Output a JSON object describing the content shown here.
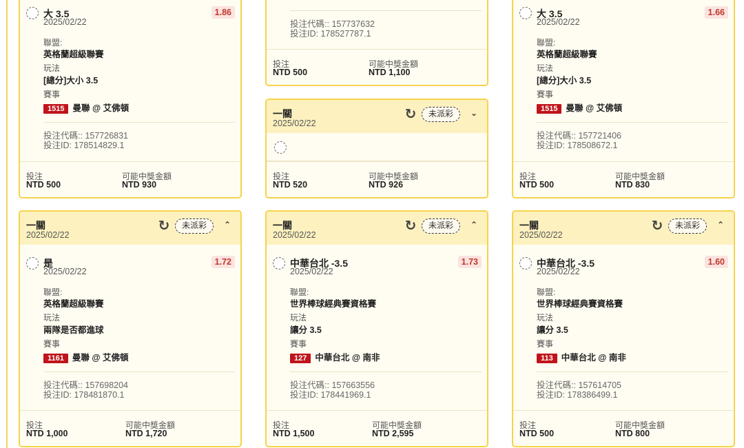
{
  "labels": {
    "league": "聯盟:",
    "market": "玩法",
    "match": "賽事",
    "bet_code": "投注代碼::",
    "bet_id": "投注ID:",
    "stake": "投注",
    "potential_win": "可能中獎金額"
  },
  "cards": [
    {
      "selection": "大 3.5",
      "date": "2025/02/22",
      "odds": "1.86",
      "league": "英格蘭超級聯賽",
      "market": "[總分]大小 3.5",
      "match_no": "1515",
      "match": "曼聯 @ 艾佛頓",
      "bet_code": "157726831",
      "bet_id": "178514829.1",
      "stake": "NTD 500",
      "win": "NTD 930"
    },
    {
      "bet_code": "157737632",
      "bet_id": "178527787.1",
      "stake": "NTD 500",
      "win": "NTD 1,100"
    },
    {
      "selection": "大 3.5",
      "date": "2025/02/22",
      "odds": "1.66",
      "league": "英格蘭超級聯賽",
      "market": "[總分]大小 3.5",
      "match_no": "1515",
      "match": "曼聯 @ 艾佛頓",
      "bet_code": "157721406",
      "bet_id": "178508672.1",
      "stake": "NTD 500",
      "win": "NTD 830"
    },
    {
      "type": "一關",
      "date": "2025/02/22",
      "status": "未派彩",
      "stake": "NTD 520",
      "win": "NTD 926"
    },
    {
      "type": "一關",
      "header_date": "2025/02/22",
      "status": "未派彩",
      "selection": "是",
      "date": "2025/02/22",
      "odds": "1.72",
      "league": "英格蘭超級聯賽",
      "market": "兩隊是否都進球",
      "match_no": "1161",
      "match": "曼聯 @ 艾佛頓",
      "bet_code": "157698204",
      "bet_id": "178481870.1",
      "stake": "NTD 1,000",
      "win": "NTD 1,720"
    },
    {
      "type": "一關",
      "header_date": "2025/02/22",
      "status": "未派彩",
      "selection": "中華台北 -3.5",
      "date": "2025/02/22",
      "odds": "1.73",
      "league": "世界棒球經典賽資格賽",
      "market": "讓分 3.5",
      "match_no": "127",
      "match": "中華台北 @ 南非",
      "bet_code": "157663556",
      "bet_id": "178441969.1",
      "stake": "NTD 1,500",
      "win": "NTD 2,595"
    },
    {
      "type": "一關",
      "header_date": "2025/02/22",
      "status": "未派彩",
      "selection": "中華台北 -3.5",
      "date": "2025/02/22",
      "odds": "1.60",
      "league": "世界棒球經典賽資格賽",
      "market": "讓分 3.5",
      "match_no": "113",
      "match": "中華台北 @ 南非",
      "bet_code": "157614705",
      "bet_id": "178386499.1",
      "stake": "NTD 500",
      "win": "NTD 800"
    }
  ]
}
